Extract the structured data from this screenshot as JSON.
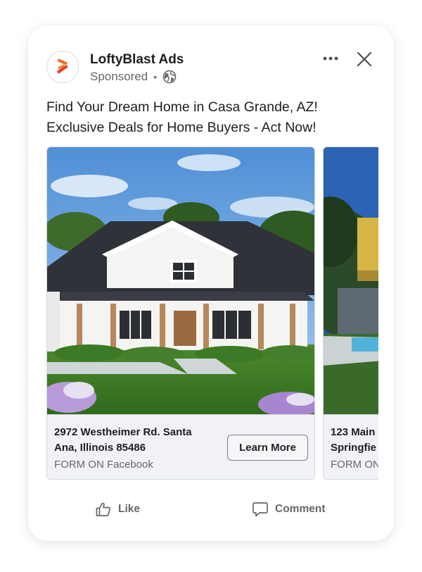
{
  "ad": {
    "advertiser": "LoftyBlast Ads",
    "sponsored_label": "Sponsored",
    "separator": "•",
    "message_line1": "Find Your Dream Home in Casa Grande, AZ!",
    "message_line2": "Exclusive Deals for Home Buyers - Act Now!"
  },
  "icons": {
    "logo": "lofty-logo-icon",
    "audience": "globe-icon",
    "more": "more-options-icon",
    "close": "close-icon",
    "like": "thumbs-up-icon",
    "comment": "comment-bubble-icon"
  },
  "carousel": {
    "cards": [
      {
        "address_line1": "2972 Westheimer Rd. Santa",
        "address_line2": "Ana, Illinois 85486",
        "source": "FORM ON Facebook",
        "cta": "Learn More"
      },
      {
        "address_line1": "123 Main",
        "address_line2": "Springfie",
        "source": "FORM ON"
      }
    ]
  },
  "actions": {
    "like": "Like",
    "comment": "Comment"
  },
  "colors": {
    "brand_orange": "#f26a21",
    "brand_red": "#e8402a",
    "text_primary": "#1c1e21",
    "text_secondary": "#65676b",
    "footer_bg": "#f0f2f5"
  }
}
